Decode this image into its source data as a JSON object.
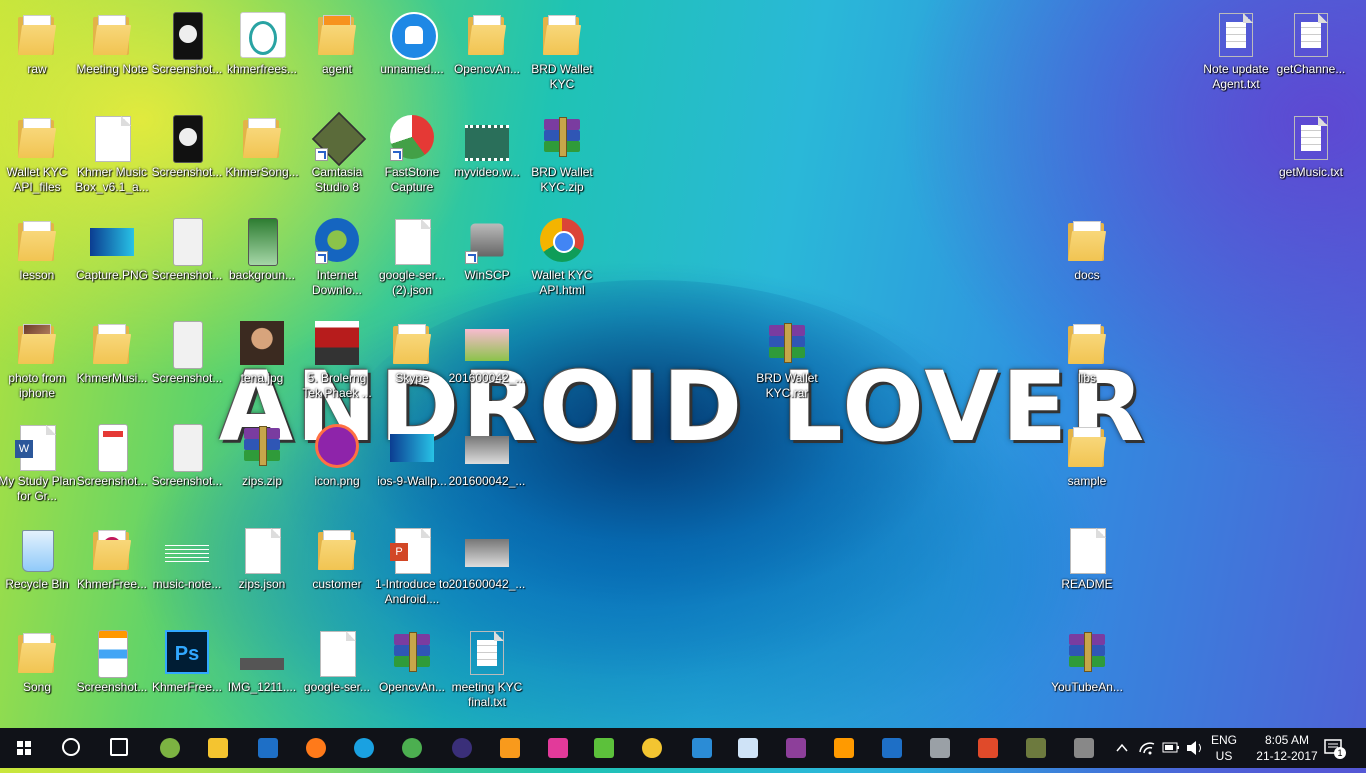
{
  "desktop": {
    "watermark": "ANDROID LOVER",
    "icons": [
      {
        "label": "raw",
        "kind": "folder"
      },
      {
        "label": "Meeting Note",
        "kind": "folder"
      },
      {
        "label": "Screenshot...",
        "kind": "phone-dark"
      },
      {
        "label": "khmerfrees...",
        "kind": "image-logo"
      },
      {
        "label": "agent",
        "kind": "folder-orange"
      },
      {
        "label": "unnamed....",
        "kind": "android-circle"
      },
      {
        "label": "OpencvAn...",
        "kind": "folder"
      },
      {
        "label": "BRD Wallet KYC",
        "kind": "folder"
      },
      {
        "label": "Wallet KYC API_files",
        "kind": "folder"
      },
      {
        "label": "Khmer Music Box_v6.1_a...",
        "kind": "doc"
      },
      {
        "label": "Screenshot...",
        "kind": "phone-dark"
      },
      {
        "label": "KhmerSong...",
        "kind": "folder"
      },
      {
        "label": "Camtasia Studio 8",
        "kind": "app-camtasia"
      },
      {
        "label": "FastStone Capture",
        "kind": "app-faststone"
      },
      {
        "label": "myvideo.w...",
        "kind": "video"
      },
      {
        "label": "BRD Wallet KYC.zip",
        "kind": "rar"
      },
      {
        "label": "lesson",
        "kind": "folder"
      },
      {
        "label": "Capture.PNG",
        "kind": "image-blue"
      },
      {
        "label": "Screenshot...",
        "kind": "phone-light"
      },
      {
        "label": "backgroun...",
        "kind": "phone-green"
      },
      {
        "label": "Internet Downlo...",
        "kind": "app-idm"
      },
      {
        "label": "google-ser... (2).json",
        "kind": "doc"
      },
      {
        "label": "WinSCP",
        "kind": "app-winscp"
      },
      {
        "label": "Wallet KYC API.html",
        "kind": "chrome"
      },
      {
        "label": "photo from iphone",
        "kind": "folder-photo"
      },
      {
        "label": "KhmerMusi...",
        "kind": "folder"
      },
      {
        "label": "Screenshot...",
        "kind": "phone-light"
      },
      {
        "label": "tena.jpg",
        "kind": "photo-face"
      },
      {
        "label": "5. Brolerng Tek Phaek ...",
        "kind": "photo-poster"
      },
      {
        "label": "Skype",
        "kind": "folder"
      },
      {
        "label": "201600042_...",
        "kind": "photo-tree"
      },
      {
        "label": "My Study Plan for Gr...",
        "kind": "word"
      },
      {
        "label": "Screenshot...",
        "kind": "phone-red"
      },
      {
        "label": "Screenshot...",
        "kind": "phone-light"
      },
      {
        "label": "zips.zip",
        "kind": "rar"
      },
      {
        "label": "icon.png",
        "kind": "icon-purple"
      },
      {
        "label": "ios-9-Wallp...",
        "kind": "image-blue"
      },
      {
        "label": "201600042_...",
        "kind": "photo-gray"
      },
      {
        "label": "Recycle Bin",
        "kind": "recycle"
      },
      {
        "label": "KhmerFree...",
        "kind": "folder-disc"
      },
      {
        "label": "music-note...",
        "kind": "music"
      },
      {
        "label": "zips.json",
        "kind": "doc"
      },
      {
        "label": "customer",
        "kind": "folder"
      },
      {
        "label": "1-Introduce to Android....",
        "kind": "ppt"
      },
      {
        "label": "201600042_...",
        "kind": "photo-gray"
      },
      {
        "label": "Song",
        "kind": "folder"
      },
      {
        "label": "Screenshot...",
        "kind": "phone-color"
      },
      {
        "label": "KhmerFree...",
        "kind": "psd"
      },
      {
        "label": "IMG_1211....",
        "kind": "photo-strip"
      },
      {
        "label": "google-ser...",
        "kind": "doc"
      },
      {
        "label": "OpencvAn...",
        "kind": "rar"
      },
      {
        "label": "meeting KYC final.txt",
        "kind": "txt"
      },
      {
        "label": "BRD Wallet KYC.rar",
        "kind": "rar"
      },
      {
        "label": "Note update Agent.txt",
        "kind": "txt"
      },
      {
        "label": "getChanne...",
        "kind": "txt"
      },
      {
        "label": "getMusic.txt",
        "kind": "txt"
      },
      {
        "label": "docs",
        "kind": "folder"
      },
      {
        "label": "libs",
        "kind": "folder"
      },
      {
        "label": "sample",
        "kind": "folder"
      },
      {
        "label": "README",
        "kind": "doc"
      },
      {
        "label": "YouTubeAn...",
        "kind": "rar"
      }
    ]
  },
  "taskbar": {
    "start_icon": "windows-start-icon",
    "apps": [
      {
        "name": "search-icon",
        "color": "#ffffff"
      },
      {
        "name": "task-view-icon",
        "color": "#ffffff"
      },
      {
        "name": "android-studio-icon",
        "color": "#7cb342"
      },
      {
        "name": "file-explorer-icon",
        "color": "#f4c430"
      },
      {
        "name": "outlook-icon",
        "color": "#1e6fc6"
      },
      {
        "name": "firefox-icon",
        "color": "#ff7a1a"
      },
      {
        "name": "skype-icon",
        "color": "#1aa1e1"
      },
      {
        "name": "chrome-icon",
        "color": "#4caf50"
      },
      {
        "name": "eclipse-icon",
        "color": "#3a2f79"
      },
      {
        "name": "sublime-icon",
        "color": "#f89a1c"
      },
      {
        "name": "winrar-w-icon",
        "color": "#e23a9a"
      },
      {
        "name": "wechat-icon",
        "color": "#5cc13b"
      },
      {
        "name": "crystal-icon",
        "color": "#f3c531"
      },
      {
        "name": "photoshop-icon",
        "color": "#2b8cd6"
      },
      {
        "name": "notepad-icon",
        "color": "#cfe3f7"
      },
      {
        "name": "onenote-icon",
        "color": "#8d3f9a"
      },
      {
        "name": "illustrator-icon",
        "color": "#ff9a00"
      },
      {
        "name": "maps-pin-icon",
        "color": "#1e6fc6"
      },
      {
        "name": "database-icon",
        "color": "#9aa0a6"
      },
      {
        "name": "faststone-icon",
        "color": "#e04a2a"
      },
      {
        "name": "camtasia-icon",
        "color": "#6d7a3e"
      },
      {
        "name": "winscp-icon",
        "color": "#888888"
      }
    ],
    "tray": {
      "chevron": "chevron-up-icon",
      "network": "wifi-icon",
      "battery": "battery-icon",
      "volume": "speaker-icon",
      "lang_top": "ENG",
      "lang_bottom": "US",
      "time": "8:05 AM",
      "date": "21-12-2017",
      "notifications": "1"
    }
  }
}
